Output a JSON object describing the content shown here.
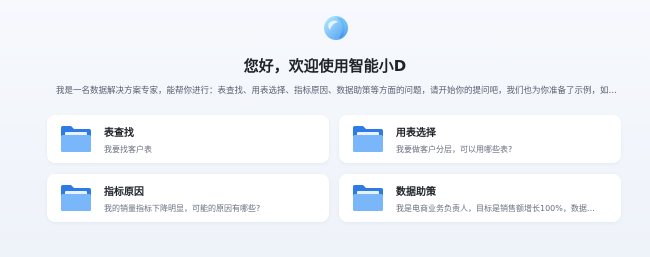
{
  "welcome": {
    "title": "您好，欢迎使用智能小D",
    "intro": "我是一名数据解决方案专家，能帮你进行：表查找、用表选择、指标原因、数据助策等方面的问题，请开始你的提问吧，我们也为你准备了示例，如…"
  },
  "cards": [
    {
      "title": "表查找",
      "desc": "我要找客户表",
      "icon": "folder-icon"
    },
    {
      "title": "用表选择",
      "desc": "我要做客户分层，可以用哪些表?",
      "icon": "folder-icon"
    },
    {
      "title": "指标原因",
      "desc": "我的销量指标下降明显，可能的原因有哪些?",
      "icon": "folder-icon"
    },
    {
      "title": "数据助策",
      "desc": "我是电商业务负责人，目标是销售额增长100%，数据…",
      "icon": "folder-icon"
    }
  ],
  "colors": {
    "accent": "#3d8ef0",
    "folder_back": "#2f7be6",
    "folder_front": "#79b6fa"
  }
}
